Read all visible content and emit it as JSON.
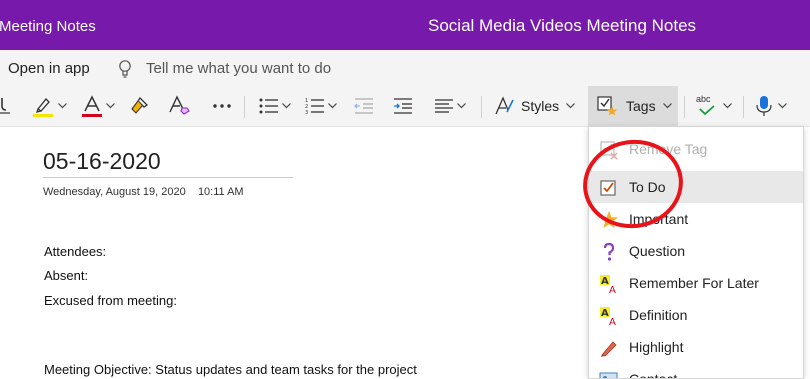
{
  "window": {
    "app_name": "Meeting Notes",
    "doc_title": "Social Media Videos Meeting Notes"
  },
  "menubar": {
    "open_in_app": "Open in app",
    "tell_me_placeholder": "Tell me what you want to do"
  },
  "ribbon": {
    "styles_label": "Styles",
    "tags_label": "Tags",
    "spell_label": "abc"
  },
  "page": {
    "date_heading": "05-16-2020",
    "meta_date": "Wednesday, August 19, 2020",
    "meta_time": "10:11 AM",
    "lines": [
      "Attendees:",
      "Absent:",
      "Excused from meeting:",
      "Meeting Objective: Status updates and team tasks for the project"
    ]
  },
  "tags_menu": {
    "items": [
      {
        "label": "Remove Tag",
        "icon": "remove-tag-icon",
        "disabled": true
      },
      {
        "label": "To Do",
        "icon": "todo-checkbox-icon"
      },
      {
        "label": "Important",
        "icon": "star-icon"
      },
      {
        "label": "Question",
        "icon": "question-icon"
      },
      {
        "label": "Remember For Later",
        "icon": "remember-highlight-icon"
      },
      {
        "label": "Definition",
        "icon": "definition-highlight-icon"
      },
      {
        "label": "Highlight",
        "icon": "highlight-pen-icon"
      },
      {
        "label": "Contact",
        "icon": "contact-icon"
      }
    ]
  },
  "colors": {
    "title_bar": "#7719aa",
    "font_color_underline": "#d0021b",
    "highlight_underline": "#f3e600",
    "annotation_circle": "#e8141a"
  }
}
